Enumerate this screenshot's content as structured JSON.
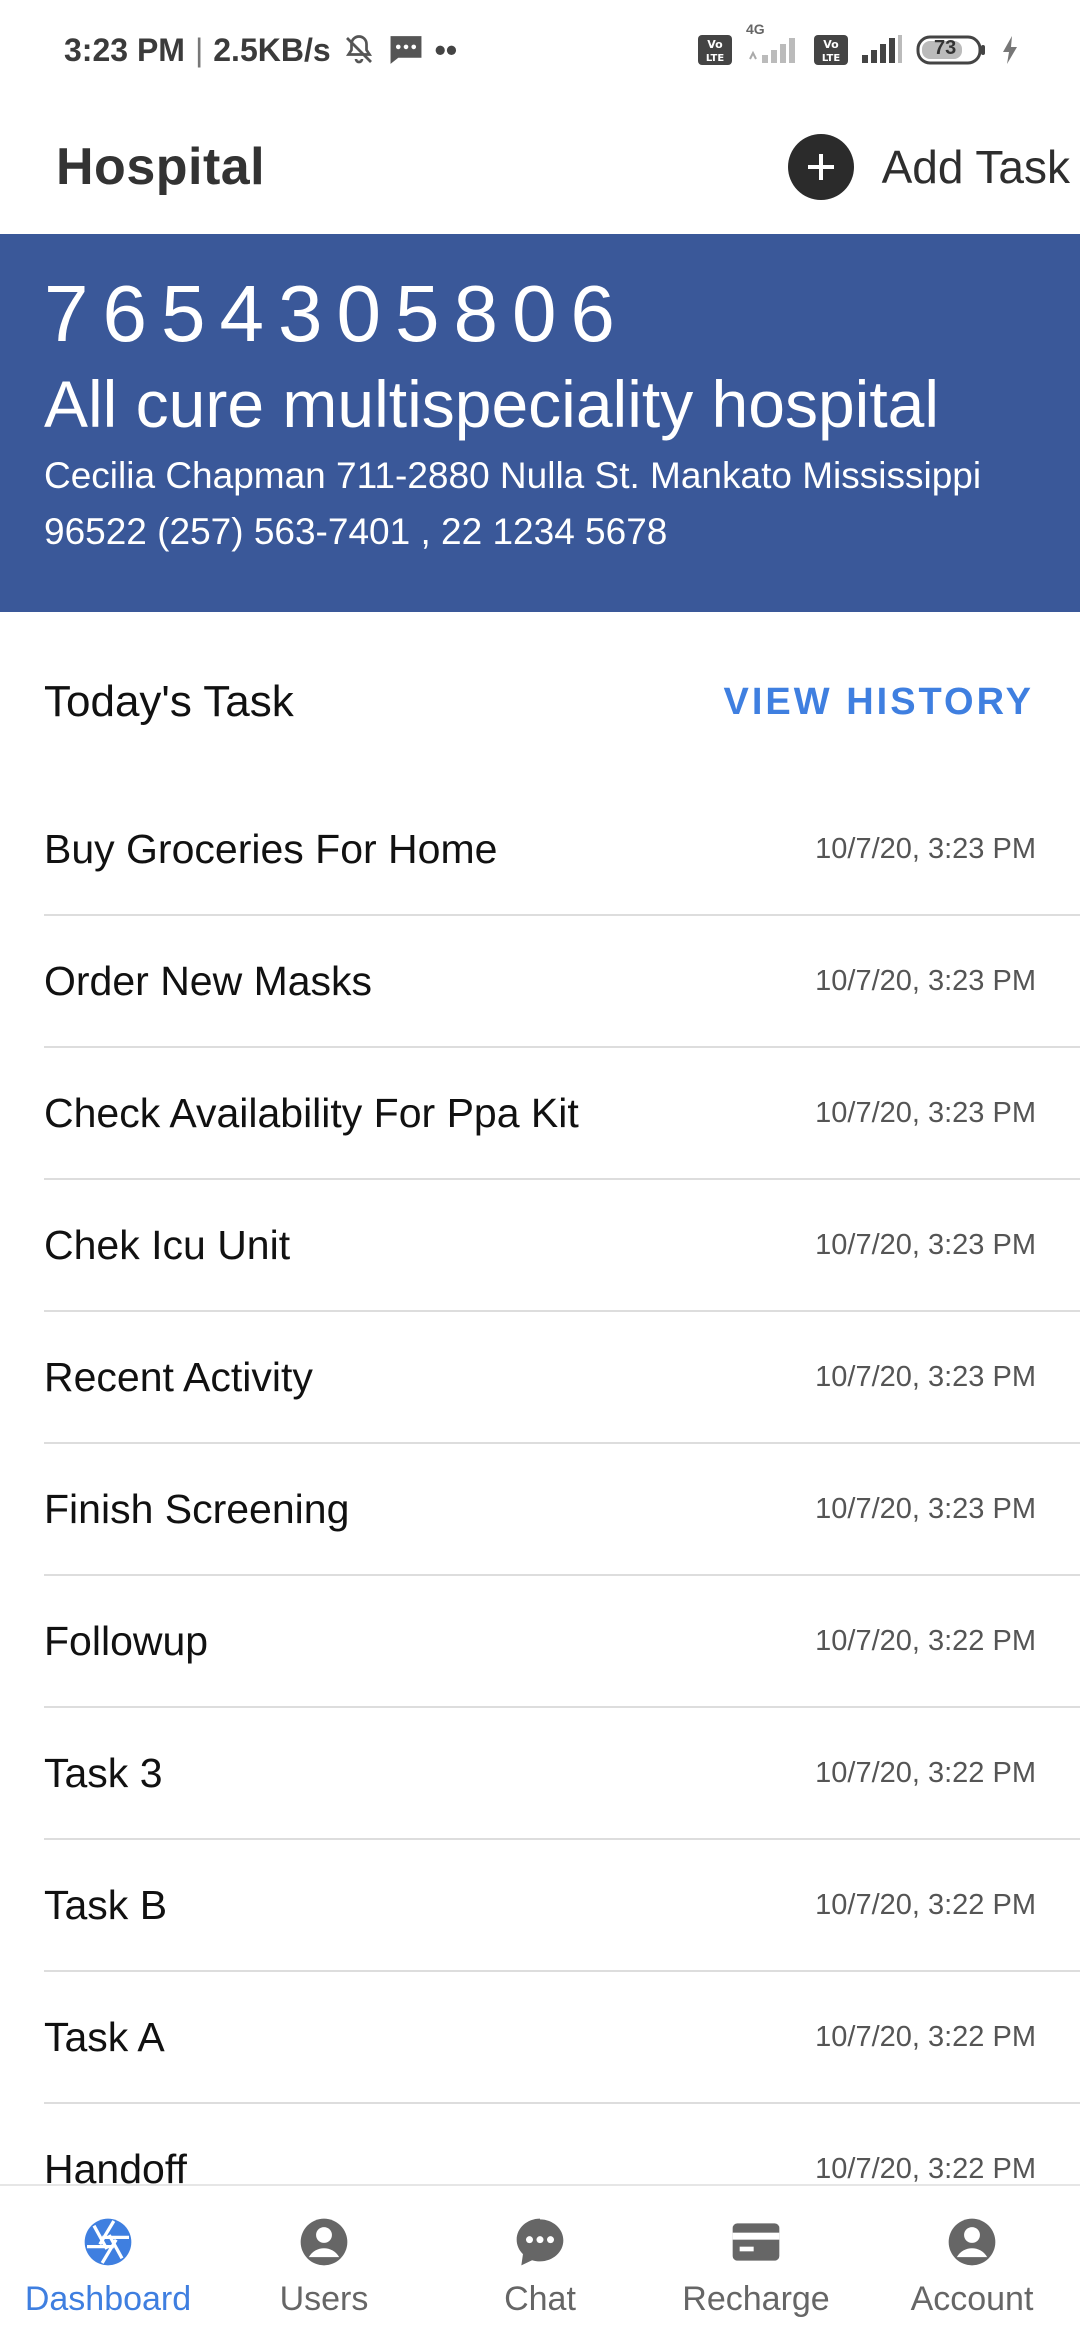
{
  "status_bar": {
    "time": "3:23 PM",
    "separator": "|",
    "speed": "2.5KB/s",
    "more": "••",
    "network_1": "4G",
    "volte_label": "Vo LTE",
    "battery": "73",
    "icons": [
      "mute-icon",
      "message-icon",
      "volte-icon",
      "signal-icon",
      "battery-icon",
      "charging-icon"
    ]
  },
  "app_bar": {
    "title": "Hospital",
    "add_task_label": "Add Task"
  },
  "banner": {
    "phone": "7654305806",
    "name": "All cure multispeciality hospital",
    "address_line1": "Cecilia Chapman 711-2880 Nulla St. Mankato Mississippi",
    "address_line2": "96522 (257) 563-7401 , 22 1234 5678",
    "background_color": "#3a5899"
  },
  "tasks_section": {
    "title": "Today's Task",
    "view_history_label": "VIEW HISTORY",
    "accent_color": "#3f7fe0"
  },
  "tasks": [
    {
      "name": "Buy Groceries For Home",
      "time": "10/7/20, 3:23 PM"
    },
    {
      "name": "Order New Masks",
      "time": "10/7/20, 3:23 PM"
    },
    {
      "name": "Check Availability For Ppa Kit",
      "time": "10/7/20, 3:23 PM"
    },
    {
      "name": "Chek Icu Unit",
      "time": "10/7/20, 3:23 PM"
    },
    {
      "name": "Recent Activity",
      "time": "10/7/20, 3:23 PM"
    },
    {
      "name": "Finish Screening",
      "time": "10/7/20, 3:23 PM"
    },
    {
      "name": "Followup",
      "time": "10/7/20, 3:22 PM"
    },
    {
      "name": "Task 3",
      "time": "10/7/20, 3:22 PM"
    },
    {
      "name": "Task B",
      "time": "10/7/20, 3:22 PM"
    },
    {
      "name": "Task A",
      "time": "10/7/20, 3:22 PM"
    },
    {
      "name": "Handoff",
      "time": "10/7/20, 3:22 PM"
    }
  ],
  "bottom_nav": {
    "active_index": 0,
    "items": [
      {
        "label": "Dashboard",
        "icon": "aperture-icon"
      },
      {
        "label": "Users",
        "icon": "user-circle-icon"
      },
      {
        "label": "Chat",
        "icon": "chat-bubble-icon"
      },
      {
        "label": "Recharge",
        "icon": "credit-card-icon"
      },
      {
        "label": "Account",
        "icon": "account-circle-icon"
      }
    ]
  }
}
